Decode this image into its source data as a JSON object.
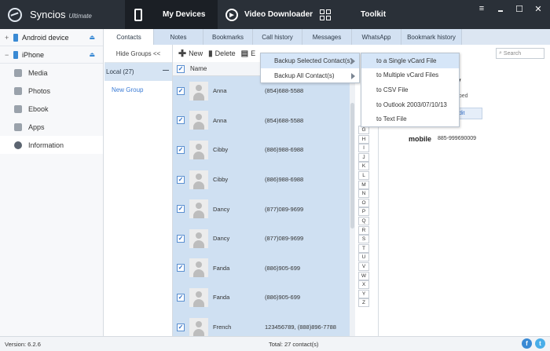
{
  "app": {
    "name": "Syncios",
    "edition": "Ultimate"
  },
  "nav": {
    "my_devices": "My Devices",
    "video_downloader": "Video Downloader",
    "toolkit": "Toolkit"
  },
  "window_controls": {
    "menu": "≡",
    "minimize": "▬",
    "maximize": "☐",
    "close": "✕"
  },
  "sidebar": {
    "devices": [
      {
        "label": "Android device",
        "expander": "+",
        "eject": "⏏"
      },
      {
        "label": "iPhone",
        "expander": "−",
        "eject": "⏏"
      }
    ],
    "items": [
      {
        "label": "Media",
        "icon": "media-icon"
      },
      {
        "label": "Photos",
        "icon": "photos-icon"
      },
      {
        "label": "Ebook",
        "icon": "ebook-icon"
      },
      {
        "label": "Apps",
        "icon": "apps-icon"
      },
      {
        "label": "Information",
        "icon": "info-icon"
      }
    ]
  },
  "tabs": [
    "Contacts",
    "Notes",
    "Bookmarks",
    "Call history",
    "Messages",
    "WhatsApp",
    "Bookmark history"
  ],
  "groups": {
    "hide": "Hide Groups <<",
    "local": "Local (27)",
    "new_group": "New Group",
    "collapse": "—"
  },
  "toolbar": {
    "new": "New",
    "delete": "Delete",
    "export": "E",
    "search_placeholder": "Search"
  },
  "list": {
    "header_name": "Name",
    "rows": [
      {
        "name": "Anna",
        "phone": "(854)688-5588"
      },
      {
        "name": "Anna",
        "phone": "(854)688-5588"
      },
      {
        "name": "Cibby",
        "phone": "(886)988-6988"
      },
      {
        "name": "Cibby",
        "phone": "(886)988-6988"
      },
      {
        "name": "Dancy",
        "phone": "(877)089-9699"
      },
      {
        "name": "Dancy",
        "phone": "(877)089-9699"
      },
      {
        "name": "Fanda",
        "phone": "(886)905-699"
      },
      {
        "name": "Fanda",
        "phone": "(886)905-699"
      },
      {
        "name": "French",
        "phone": "123456789, (888)896-7788"
      }
    ]
  },
  "alphabet": [
    "G",
    "H",
    "I",
    "J",
    "K",
    "L",
    "M",
    "N",
    "O",
    "P",
    "Q",
    "R",
    "S",
    "T",
    "U",
    "V",
    "W",
    "X",
    "Y",
    "Z"
  ],
  "detail": {
    "title_fragment": "y",
    "group_fragment": "uped",
    "edit_fragment": "dit",
    "mobile_label": "mobile",
    "mobile_number": "885-999690009"
  },
  "menu_backup": {
    "items": [
      "Backup Selected Contact(s)",
      "Backup All Contact(s)"
    ]
  },
  "menu_export": {
    "items": [
      "to a Single vCard File",
      "to Multiple vCard Files",
      "to CSV File",
      "to Outlook 2003/07/10/13",
      "to Text File"
    ]
  },
  "status": {
    "version": "Version: 6.2.6",
    "total": "Total: 27 contact(s)",
    "facebook": "f",
    "twitter": "t"
  }
}
